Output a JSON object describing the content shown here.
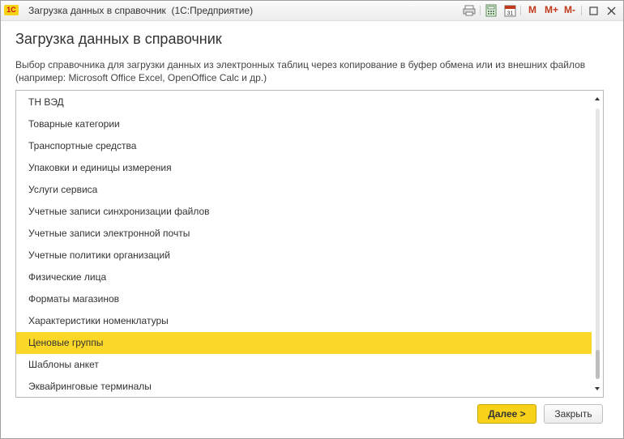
{
  "window": {
    "title": "Загрузка данных в справочник",
    "app": "(1С:Предприятие)",
    "logo_text": "1С",
    "m_buttons": [
      "M",
      "M+",
      "M-"
    ]
  },
  "form": {
    "heading": "Загрузка данных в справочник",
    "description": "Выбор справочника для загрузки данных из электронных таблиц через копирование в буфер обмена или из внешних файлов (например: Microsoft Office Excel, OpenOffice Calc и др.)"
  },
  "list": {
    "items": [
      "ТН ВЭД",
      "Товарные категории",
      "Транспортные средства",
      "Упаковки и единицы измерения",
      "Услуги сервиса",
      "Учетные записи синхронизации файлов",
      "Учетные записи электронной почты",
      "Учетные политики организаций",
      "Физические лица",
      "Форматы магазинов",
      "Характеристики номенклатуры",
      "Ценовые группы",
      "Шаблоны анкет",
      "Эквайринговые терминалы"
    ],
    "selected": "Ценовые группы"
  },
  "buttons": {
    "next": "Далее >",
    "close": "Закрыть"
  },
  "colors": {
    "selection": "#fbd827",
    "accent_button": "#f8d11b"
  },
  "icons": [
    "print-icon",
    "calculator-icon",
    "calendar-icon",
    "restore-icon",
    "close-icon"
  ]
}
